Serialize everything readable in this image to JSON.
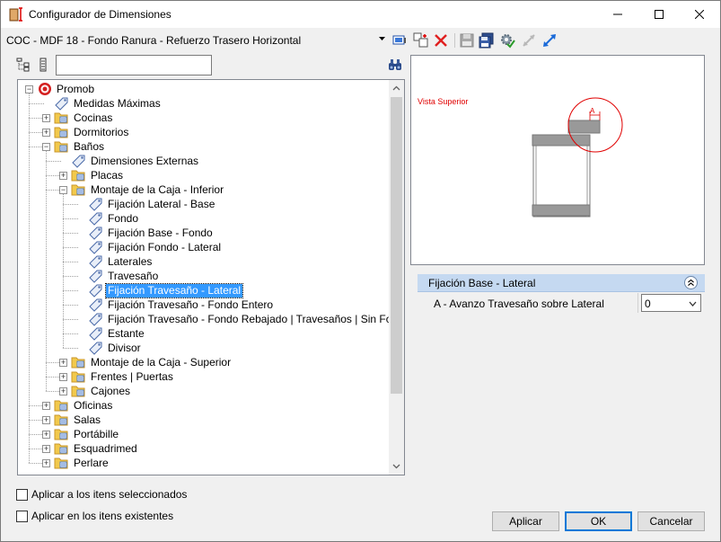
{
  "window": {
    "title": "Configurador de Dimensiones"
  },
  "toolbar": {
    "config_name": "COC - MDF 18 - Fondo Ranura - Refuerzo Trasero Horizontal",
    "icons": [
      "monitor-icon",
      "add-icon",
      "delete-icon",
      "save-icon",
      "save-all-icon",
      "apply-gear-icon",
      "collapse-arrows-icon",
      "expand-arrows-icon"
    ]
  },
  "tree_toolbar": {
    "search_value": ""
  },
  "tree": {
    "nodes": [
      {
        "label": "Promob",
        "level": 0,
        "icon": "promob-icon",
        "expander": "−"
      },
      {
        "label": "Medidas Máximas",
        "level": 1,
        "icon": "tag-icon",
        "expander": ""
      },
      {
        "label": "Cocinas",
        "level": 1,
        "icon": "folder-icon",
        "expander": "+"
      },
      {
        "label": "Dormitorios",
        "level": 1,
        "icon": "folder-icon",
        "expander": "+"
      },
      {
        "label": "Baños",
        "level": 1,
        "icon": "folder-icon",
        "expander": "−"
      },
      {
        "label": "Dimensiones Externas",
        "level": 2,
        "icon": "tag-icon",
        "expander": ""
      },
      {
        "label": "Placas",
        "level": 2,
        "icon": "folder-icon",
        "expander": "+"
      },
      {
        "label": "Montaje de la Caja - Inferior",
        "level": 2,
        "icon": "folder-icon",
        "expander": "−"
      },
      {
        "label": "Fijación Lateral - Base",
        "level": 3,
        "icon": "tag-icon",
        "expander": ""
      },
      {
        "label": "Fondo",
        "level": 3,
        "icon": "tag-icon",
        "expander": ""
      },
      {
        "label": " Fijación Base - Fondo",
        "level": 3,
        "icon": "tag-icon",
        "expander": ""
      },
      {
        "label": "Fijación Fondo - Lateral",
        "level": 3,
        "icon": "tag-icon",
        "expander": ""
      },
      {
        "label": "Laterales",
        "level": 3,
        "icon": "tag-icon",
        "expander": ""
      },
      {
        "label": "Travesaño",
        "level": 3,
        "icon": "tag-icon",
        "expander": ""
      },
      {
        "label": "Fijación Travesaño - Lateral",
        "level": 3,
        "icon": "tag-icon",
        "expander": "",
        "selected": true
      },
      {
        "label": "Fijación Travesaño - Fondo Entero",
        "level": 3,
        "icon": "tag-icon",
        "expander": ""
      },
      {
        "label": "Fijación Travesaño - Fondo Rebajado | Travesaños | Sin Fondo",
        "level": 3,
        "icon": "tag-icon",
        "expander": ""
      },
      {
        "label": "Estante",
        "level": 3,
        "icon": "tag-icon",
        "expander": ""
      },
      {
        "label": "Divisor",
        "level": 3,
        "icon": "tag-icon",
        "expander": ""
      },
      {
        "label": "Montaje de la Caja - Superior",
        "level": 2,
        "icon": "folder-icon",
        "expander": "+"
      },
      {
        "label": "Frentes | Puertas",
        "level": 2,
        "icon": "folder-icon",
        "expander": "+"
      },
      {
        "label": "Cajones",
        "level": 2,
        "icon": "folder-icon",
        "expander": "+"
      },
      {
        "label": "Oficinas",
        "level": 1,
        "icon": "folder-icon",
        "expander": "+"
      },
      {
        "label": "Salas",
        "level": 1,
        "icon": "folder-icon",
        "expander": "+"
      },
      {
        "label": "Portábille",
        "level": 1,
        "icon": "folder-icon",
        "expander": "+"
      },
      {
        "label": "Esquadrimed",
        "level": 1,
        "icon": "folder-icon",
        "expander": "+"
      },
      {
        "label": "Perlare",
        "level": 1,
        "icon": "folder-icon",
        "expander": "+"
      }
    ]
  },
  "preview": {
    "label": "Vista Superior",
    "dimension_letter": "A"
  },
  "properties": {
    "group_title": "Fijación Base - Lateral",
    "rows": [
      {
        "name": "A - Avanzo Travesaño sobre Lateral",
        "value": "0"
      }
    ]
  },
  "options": {
    "apply_selected": "Aplicar a los itens seleccionados",
    "apply_existing": "Aplicar en los itens existentes"
  },
  "buttons": {
    "apply": "Aplicar",
    "ok": "OK",
    "cancel": "Cancelar"
  },
  "colors": {
    "selection": "#3399ff",
    "group_header": "#c5d9f1",
    "preview_label": "#e00000"
  }
}
